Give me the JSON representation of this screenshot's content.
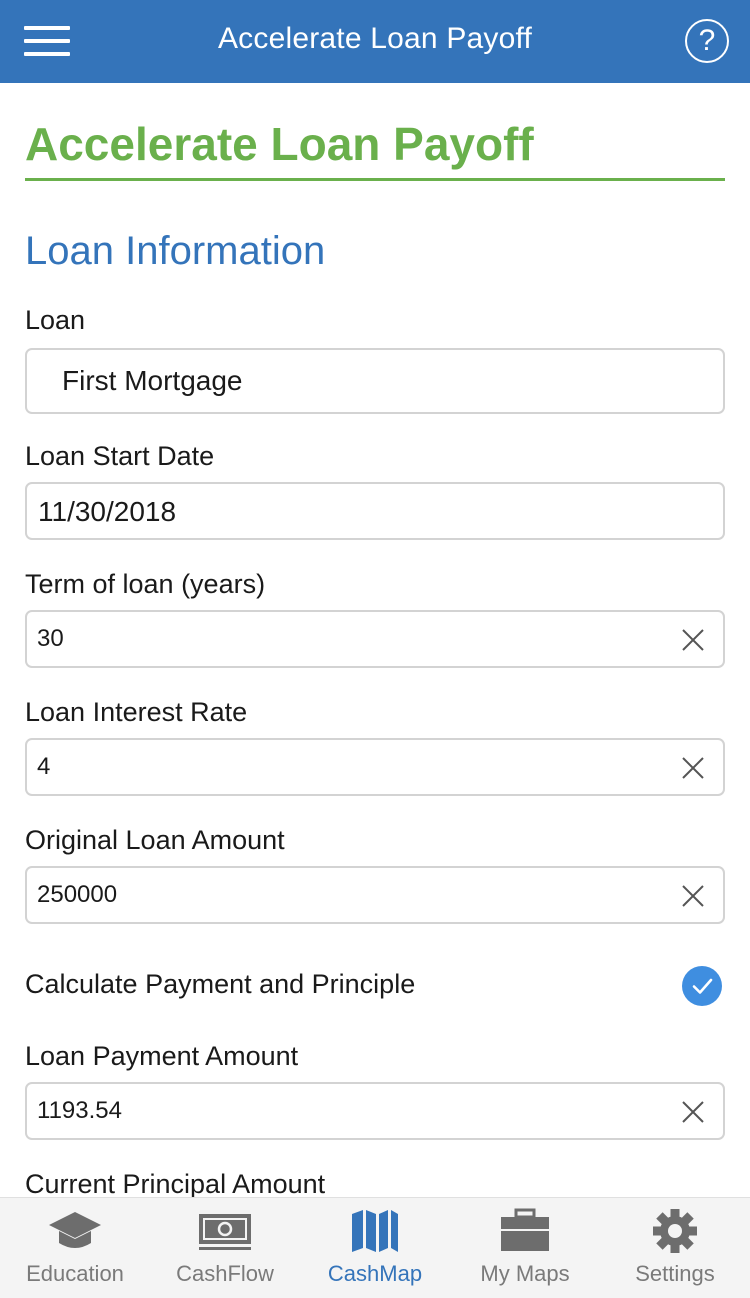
{
  "header": {
    "title": "Accelerate Loan Payoff",
    "help_icon": "?"
  },
  "page": {
    "title": "Accelerate Loan Payoff",
    "section_title": "Loan Information"
  },
  "form": {
    "loan": {
      "label": "Loan",
      "value": "First Mortgage"
    },
    "start_date": {
      "label": "Loan Start Date",
      "value": "11/30/2018"
    },
    "term": {
      "label": "Term of loan (years)",
      "value": "30"
    },
    "rate": {
      "label": "Loan Interest Rate",
      "value": "4"
    },
    "original_amount": {
      "label": "Original Loan Amount",
      "value": "250000"
    },
    "calculate": {
      "label": "Calculate Payment and Principle",
      "checked": true
    },
    "payment": {
      "label": "Loan Payment Amount",
      "value": "1193.54"
    },
    "current_principal": {
      "label": "Current Principal Amount"
    }
  },
  "tabs": [
    {
      "label": "Education",
      "icon": "graduation-cap-icon",
      "active": false
    },
    {
      "label": "CashFlow",
      "icon": "cash-icon",
      "active": false
    },
    {
      "label": "CashMap",
      "icon": "map-icon",
      "active": true
    },
    {
      "label": "My Maps",
      "icon": "briefcase-icon",
      "active": false
    },
    {
      "label": "Settings",
      "icon": "gear-icon",
      "active": false
    }
  ],
  "colors": {
    "header_bg": "#3474ba",
    "title_green": "#6ab04c",
    "section_blue": "#3474ba",
    "active_tab": "#3474ba",
    "inactive_tab": "#7a7a7a",
    "check_blue": "#3f8ee0"
  }
}
